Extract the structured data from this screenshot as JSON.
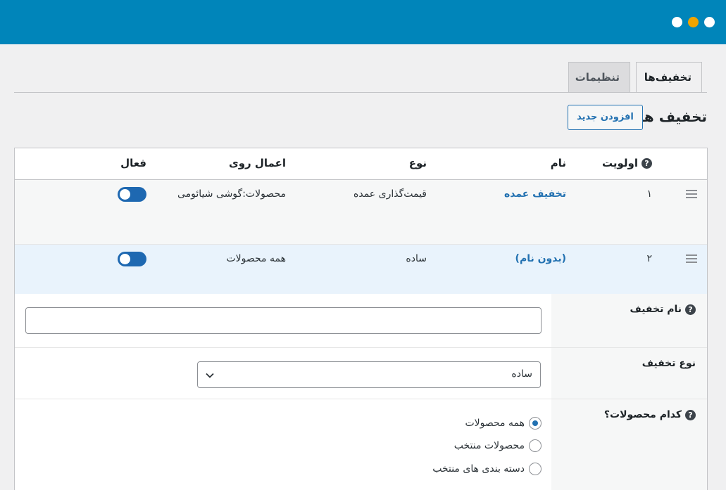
{
  "window": {
    "controls": [
      "close",
      "minimize",
      "maximize"
    ],
    "colors": {
      "topbar": "#0085ba",
      "accent": "#2271b1",
      "toggle": "#1e68b1",
      "dot_orange": "#f0a400"
    }
  },
  "tabs": [
    {
      "label": "تخفیف‌ها",
      "active": true
    },
    {
      "label": "تنظیمات",
      "active": false
    }
  ],
  "section": {
    "title": "تخفیف ها",
    "add_button": "افزودن جدید"
  },
  "table": {
    "headers": {
      "priority": "اولویت",
      "name": "نام",
      "type": "نوع",
      "applies_to": "اعمال روی",
      "active": "فعال"
    },
    "rows": [
      {
        "priority": "۱",
        "name": "تخفیف عمده",
        "type": "قیمت‌گذاری عمده",
        "applies_to": "محصولات:گوشی شیائومی",
        "active": true
      },
      {
        "priority": "۲",
        "name": "(بدون نام)",
        "type": "ساده",
        "applies_to": "همه محصولات",
        "active": true
      }
    ]
  },
  "form": {
    "name_label": "نام تخفیف",
    "name_value": "",
    "type_label": "نوع تخفیف",
    "type_value": "ساده",
    "products_label": "کدام محصولات؟",
    "product_options": [
      {
        "label": "همه محصولات",
        "checked": true
      },
      {
        "label": "محصولات منتخب",
        "checked": false
      },
      {
        "label": "دسته بندی های منتخب",
        "checked": false
      }
    ]
  }
}
